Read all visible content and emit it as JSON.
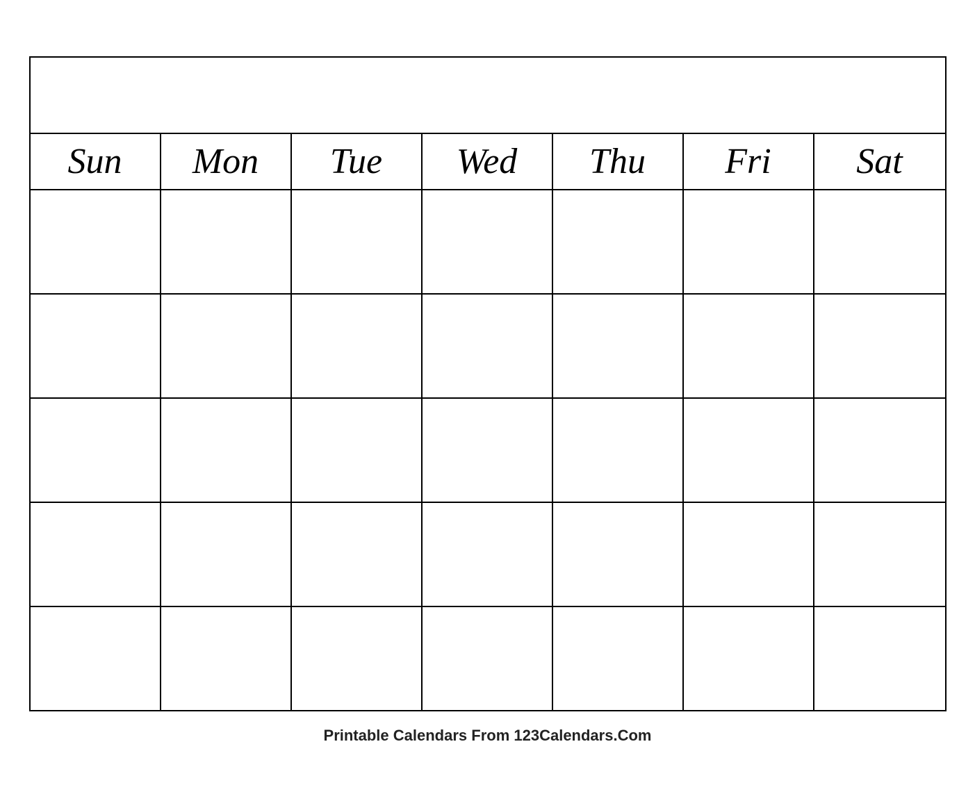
{
  "calendar": {
    "title": "",
    "days": [
      "Sun",
      "Mon",
      "Tue",
      "Wed",
      "Thu",
      "Fri",
      "Sat"
    ],
    "rows": 5
  },
  "footer": {
    "text_regular": "Printable Calendars From ",
    "text_bold": "123Calendars.Com"
  }
}
